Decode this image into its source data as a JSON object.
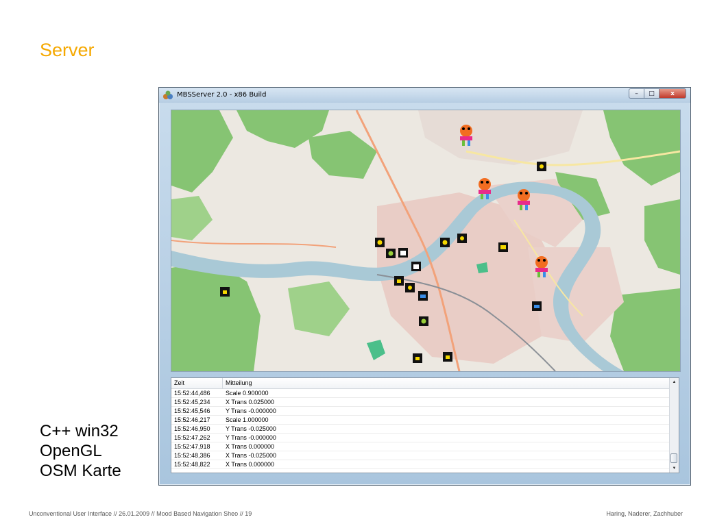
{
  "slide": {
    "title": "Server",
    "bullets": [
      "C++ win32",
      "OpenGL",
      "OSM Karte"
    ],
    "footer_left": "Unconventional User Interface // 26.01.2009 // Mood Based Navigation Sheo // 19",
    "footer_right": "Haring, Naderer, Zachhuber"
  },
  "window": {
    "title": "MBSServer 2.0 - x86 Build",
    "buttons": {
      "minimize": "–",
      "maximize": "□",
      "close": "x"
    }
  },
  "map": {
    "colors": {
      "river": "#a9c9d6",
      "forest": "#7cc16a",
      "urban": "#e8c8c4",
      "land": "#ece8e1",
      "road": "#f7e7a2"
    },
    "markers": [
      {
        "icon": "mood-figure-icon"
      },
      {
        "icon": "mood-figure-icon"
      },
      {
        "icon": "mood-figure-icon"
      },
      {
        "icon": "mood-figure-icon"
      },
      {
        "icon": "sun-icon"
      },
      {
        "icon": "sun-icon"
      },
      {
        "icon": "bank-icon"
      },
      {
        "icon": "bank-icon"
      },
      {
        "icon": "music-icon"
      },
      {
        "icon": "camera-icon"
      },
      {
        "icon": "shopping-icon"
      },
      {
        "icon": "food-icon"
      },
      {
        "icon": "theater-icon"
      },
      {
        "icon": "bus-icon"
      },
      {
        "icon": "bus-icon"
      }
    ]
  },
  "log": {
    "columns": [
      "Zeit",
      "Mitteilung"
    ],
    "rows": [
      {
        "time": "15:52:44,486",
        "message": "Scale 0.900000"
      },
      {
        "time": "15:52:45,234",
        "message": "X Trans 0.025000"
      },
      {
        "time": "15:52:45,546",
        "message": "Y Trans -0.000000"
      },
      {
        "time": "15:52:46,217",
        "message": "Scale 1.000000"
      },
      {
        "time": "15:52:46,950",
        "message": "Y Trans -0.025000"
      },
      {
        "time": "15:52:47,262",
        "message": "Y Trans -0.000000"
      },
      {
        "time": "15:52:47,918",
        "message": "X Trans 0.000000"
      },
      {
        "time": "15:52:48,386",
        "message": "X Trans -0.025000"
      },
      {
        "time": "15:52:48,822",
        "message": "X Trans 0.000000"
      }
    ]
  }
}
